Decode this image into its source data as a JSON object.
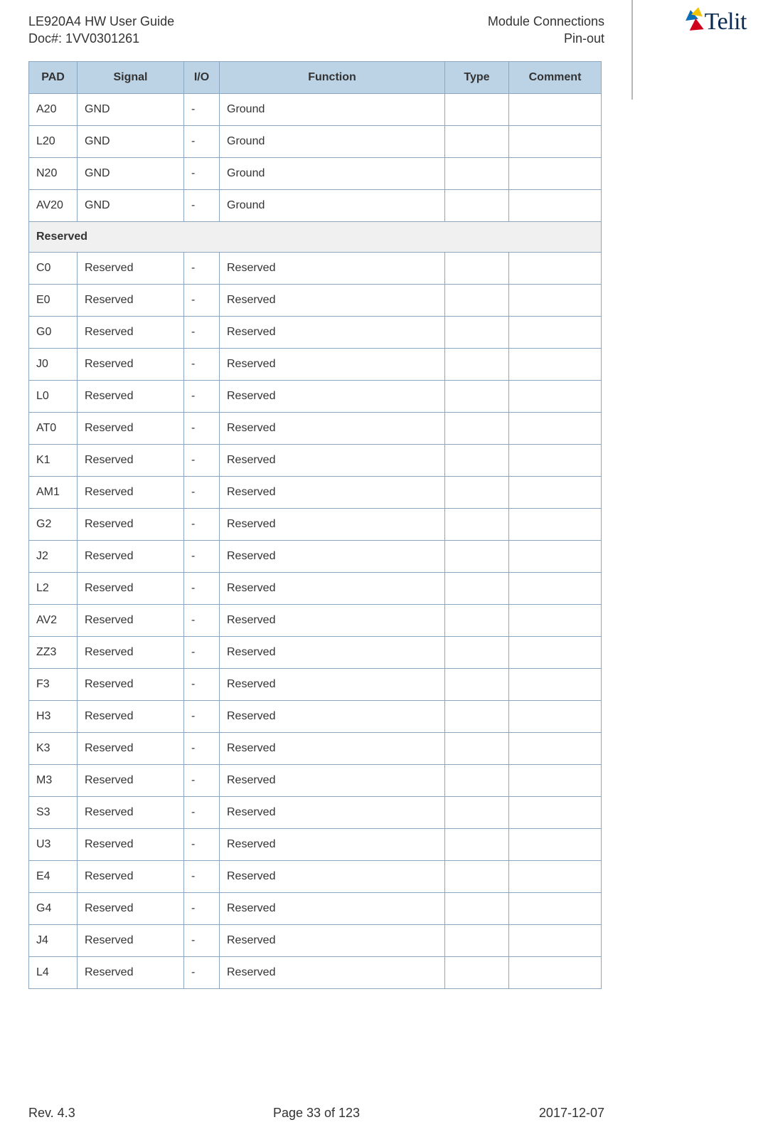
{
  "header": {
    "left_line1": "LE920A4 HW User Guide",
    "left_line2": "Doc#: 1VV0301261",
    "right_line1": "Module Connections",
    "right_line2": "Pin-out"
  },
  "logo": {
    "text": "Telit"
  },
  "columns": {
    "pad": "PAD",
    "signal": "Signal",
    "io": "I/O",
    "function": "Function",
    "type": "Type",
    "comment": "Comment"
  },
  "rows": [
    {
      "pad": "A20",
      "signal": "GND",
      "io": "-",
      "function": "Ground",
      "type": "",
      "comment": ""
    },
    {
      "pad": "L20",
      "signal": "GND",
      "io": "-",
      "function": "Ground",
      "type": "",
      "comment": ""
    },
    {
      "pad": "N20",
      "signal": "GND",
      "io": "-",
      "function": "Ground",
      "type": "",
      "comment": ""
    },
    {
      "pad": "AV20",
      "signal": "GND",
      "io": "-",
      "function": "Ground",
      "type": "",
      "comment": ""
    },
    {
      "section": "Reserved"
    },
    {
      "pad": "C0",
      "signal": "Reserved",
      "io": "-",
      "function": "Reserved",
      "type": "",
      "comment": ""
    },
    {
      "pad": "E0",
      "signal": "Reserved",
      "io": "-",
      "function": "Reserved",
      "type": "",
      "comment": ""
    },
    {
      "pad": "G0",
      "signal": "Reserved",
      "io": "-",
      "function": "Reserved",
      "type": "",
      "comment": ""
    },
    {
      "pad": "J0",
      "signal": "Reserved",
      "io": "-",
      "function": "Reserved",
      "type": "",
      "comment": ""
    },
    {
      "pad": "L0",
      "signal": "Reserved",
      "io": "-",
      "function": "Reserved",
      "type": "",
      "comment": ""
    },
    {
      "pad": "AT0",
      "signal": "Reserved",
      "io": "-",
      "function": "Reserved",
      "type": "",
      "comment": ""
    },
    {
      "pad": "K1",
      "signal": "Reserved",
      "io": "-",
      "function": "Reserved",
      "type": "",
      "comment": ""
    },
    {
      "pad": "AM1",
      "signal": "Reserved",
      "io": "-",
      "function": "Reserved",
      "type": "",
      "comment": ""
    },
    {
      "pad": "G2",
      "signal": "Reserved",
      "io": "-",
      "function": "Reserved",
      "type": "",
      "comment": ""
    },
    {
      "pad": "J2",
      "signal": "Reserved",
      "io": "-",
      "function": "Reserved",
      "type": "",
      "comment": ""
    },
    {
      "pad": "L2",
      "signal": "Reserved",
      "io": "-",
      "function": "Reserved",
      "type": "",
      "comment": ""
    },
    {
      "pad": "AV2",
      "signal": "Reserved",
      "io": "-",
      "function": "Reserved",
      "type": "",
      "comment": ""
    },
    {
      "pad": "ZZ3",
      "signal": "Reserved",
      "io": "-",
      "function": "Reserved",
      "type": "",
      "comment": ""
    },
    {
      "pad": "F3",
      "signal": "Reserved",
      "io": "-",
      "function": "Reserved",
      "type": "",
      "comment": ""
    },
    {
      "pad": "H3",
      "signal": "Reserved",
      "io": "-",
      "function": "Reserved",
      "type": "",
      "comment": ""
    },
    {
      "pad": "K3",
      "signal": "Reserved",
      "io": "-",
      "function": "Reserved",
      "type": "",
      "comment": ""
    },
    {
      "pad": "M3",
      "signal": "Reserved",
      "io": "-",
      "function": "Reserved",
      "type": "",
      "comment": ""
    },
    {
      "pad": "S3",
      "signal": "Reserved",
      "io": "-",
      "function": "Reserved",
      "type": "",
      "comment": ""
    },
    {
      "pad": "U3",
      "signal": "Reserved",
      "io": "-",
      "function": "Reserved",
      "type": "",
      "comment": ""
    },
    {
      "pad": "E4",
      "signal": "Reserved",
      "io": "-",
      "function": "Reserved",
      "type": "",
      "comment": ""
    },
    {
      "pad": "G4",
      "signal": "Reserved",
      "io": "-",
      "function": "Reserved",
      "type": "",
      "comment": ""
    },
    {
      "pad": "J4",
      "signal": "Reserved",
      "io": "-",
      "function": "Reserved",
      "type": "",
      "comment": ""
    },
    {
      "pad": "L4",
      "signal": "Reserved",
      "io": "-",
      "function": "Reserved",
      "type": "",
      "comment": ""
    }
  ],
  "footer": {
    "left": "Rev. 4.3",
    "center": "Page 33 of 123",
    "right": "2017-12-07"
  }
}
